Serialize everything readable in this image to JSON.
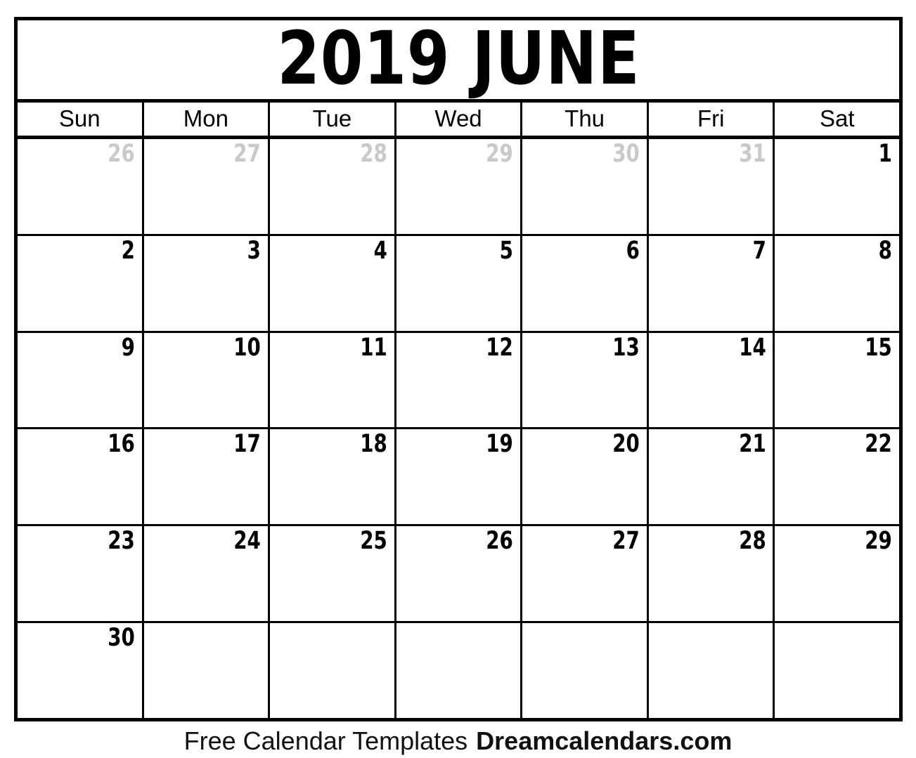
{
  "calendar": {
    "title": "2019 JUNE",
    "year": "2019",
    "month": "JUNE",
    "weekday_headers": [
      {
        "label": "Sun"
      },
      {
        "label": "Mon"
      },
      {
        "label": "Tue"
      },
      {
        "label": "Wed"
      },
      {
        "label": "Thu"
      },
      {
        "label": "Fri"
      },
      {
        "label": "Sat"
      }
    ],
    "weeks": [
      {
        "days": [
          {
            "number": "26",
            "in_month": false
          },
          {
            "number": "27",
            "in_month": false
          },
          {
            "number": "28",
            "in_month": false
          },
          {
            "number": "29",
            "in_month": false
          },
          {
            "number": "30",
            "in_month": false
          },
          {
            "number": "31",
            "in_month": false
          },
          {
            "number": "1",
            "in_month": true
          }
        ]
      },
      {
        "days": [
          {
            "number": "2",
            "in_month": true
          },
          {
            "number": "3",
            "in_month": true
          },
          {
            "number": "4",
            "in_month": true
          },
          {
            "number": "5",
            "in_month": true
          },
          {
            "number": "6",
            "in_month": true
          },
          {
            "number": "7",
            "in_month": true
          },
          {
            "number": "8",
            "in_month": true
          }
        ]
      },
      {
        "days": [
          {
            "number": "9",
            "in_month": true
          },
          {
            "number": "10",
            "in_month": true
          },
          {
            "number": "11",
            "in_month": true
          },
          {
            "number": "12",
            "in_month": true
          },
          {
            "number": "13",
            "in_month": true
          },
          {
            "number": "14",
            "in_month": true
          },
          {
            "number": "15",
            "in_month": true
          }
        ]
      },
      {
        "days": [
          {
            "number": "16",
            "in_month": true
          },
          {
            "number": "17",
            "in_month": true
          },
          {
            "number": "18",
            "in_month": true
          },
          {
            "number": "19",
            "in_month": true
          },
          {
            "number": "20",
            "in_month": true
          },
          {
            "number": "21",
            "in_month": true
          },
          {
            "number": "22",
            "in_month": true
          }
        ]
      },
      {
        "days": [
          {
            "number": "23",
            "in_month": true
          },
          {
            "number": "24",
            "in_month": true
          },
          {
            "number": "25",
            "in_month": true
          },
          {
            "number": "26",
            "in_month": true
          },
          {
            "number": "27",
            "in_month": true
          },
          {
            "number": "28",
            "in_month": true
          },
          {
            "number": "29",
            "in_month": true
          }
        ]
      },
      {
        "days": [
          {
            "number": "30",
            "in_month": true
          },
          {
            "number": "",
            "in_month": true
          },
          {
            "number": "",
            "in_month": true
          },
          {
            "number": "",
            "in_month": true
          },
          {
            "number": "",
            "in_month": true
          },
          {
            "number": "",
            "in_month": true
          },
          {
            "number": "",
            "in_month": true
          }
        ]
      }
    ]
  },
  "footer": {
    "tagline": "Free Calendar Templates",
    "site": "Dreamcalendars.com"
  },
  "colors": {
    "ink": "#000000",
    "muted_day": "#c9c9c9",
    "page_background": "#ffffff"
  }
}
